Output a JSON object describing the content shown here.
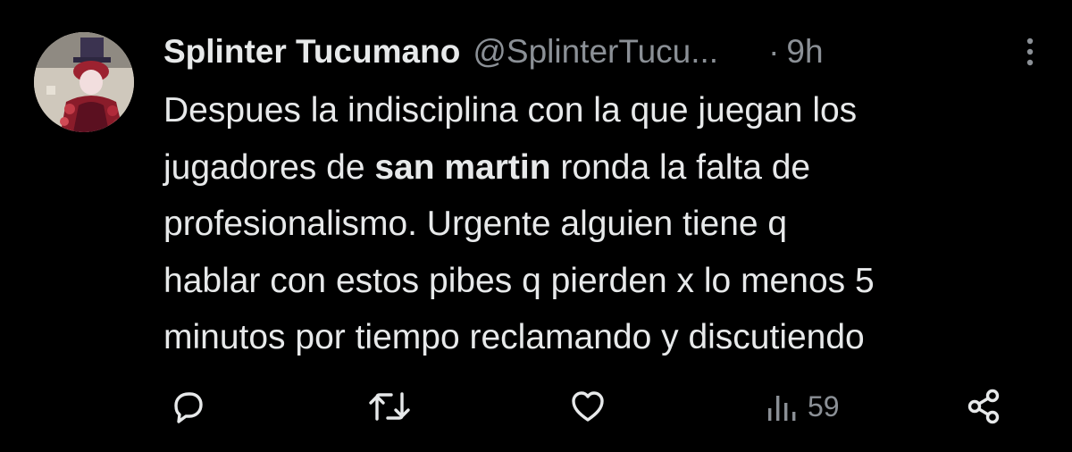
{
  "tweet": {
    "display_name": "Splinter Tucumano",
    "handle": "@SplinterTucu...",
    "dot": "·",
    "time": "9h",
    "text_lines": [
      {
        "before": "Despues la indisciplina con la que juegan los",
        "bold": "",
        "after": ""
      },
      {
        "before": "jugadores de ",
        "bold": "san martin",
        "after": " ronda la falta de"
      },
      {
        "before": "profesionalismo. Urgente alguien tiene q",
        "bold": "",
        "after": ""
      },
      {
        "before": "hablar con estos pibes q pierden x lo menos 5",
        "bold": "",
        "after": ""
      },
      {
        "before": "minutos por tiempo reclamando y discutiendo",
        "bold": "",
        "after": ""
      }
    ]
  },
  "actions": {
    "reply_icon": "reply-icon",
    "retweet_icon": "retweet-icon",
    "like_icon": "heart-icon",
    "views_icon": "views-bar-icon",
    "views_count": "59",
    "share_icon": "share-icon",
    "more_icon": "more-vertical-icon"
  },
  "colors": {
    "background": "#000000",
    "text": "#e7e9ea",
    "muted": "#8b9096"
  }
}
